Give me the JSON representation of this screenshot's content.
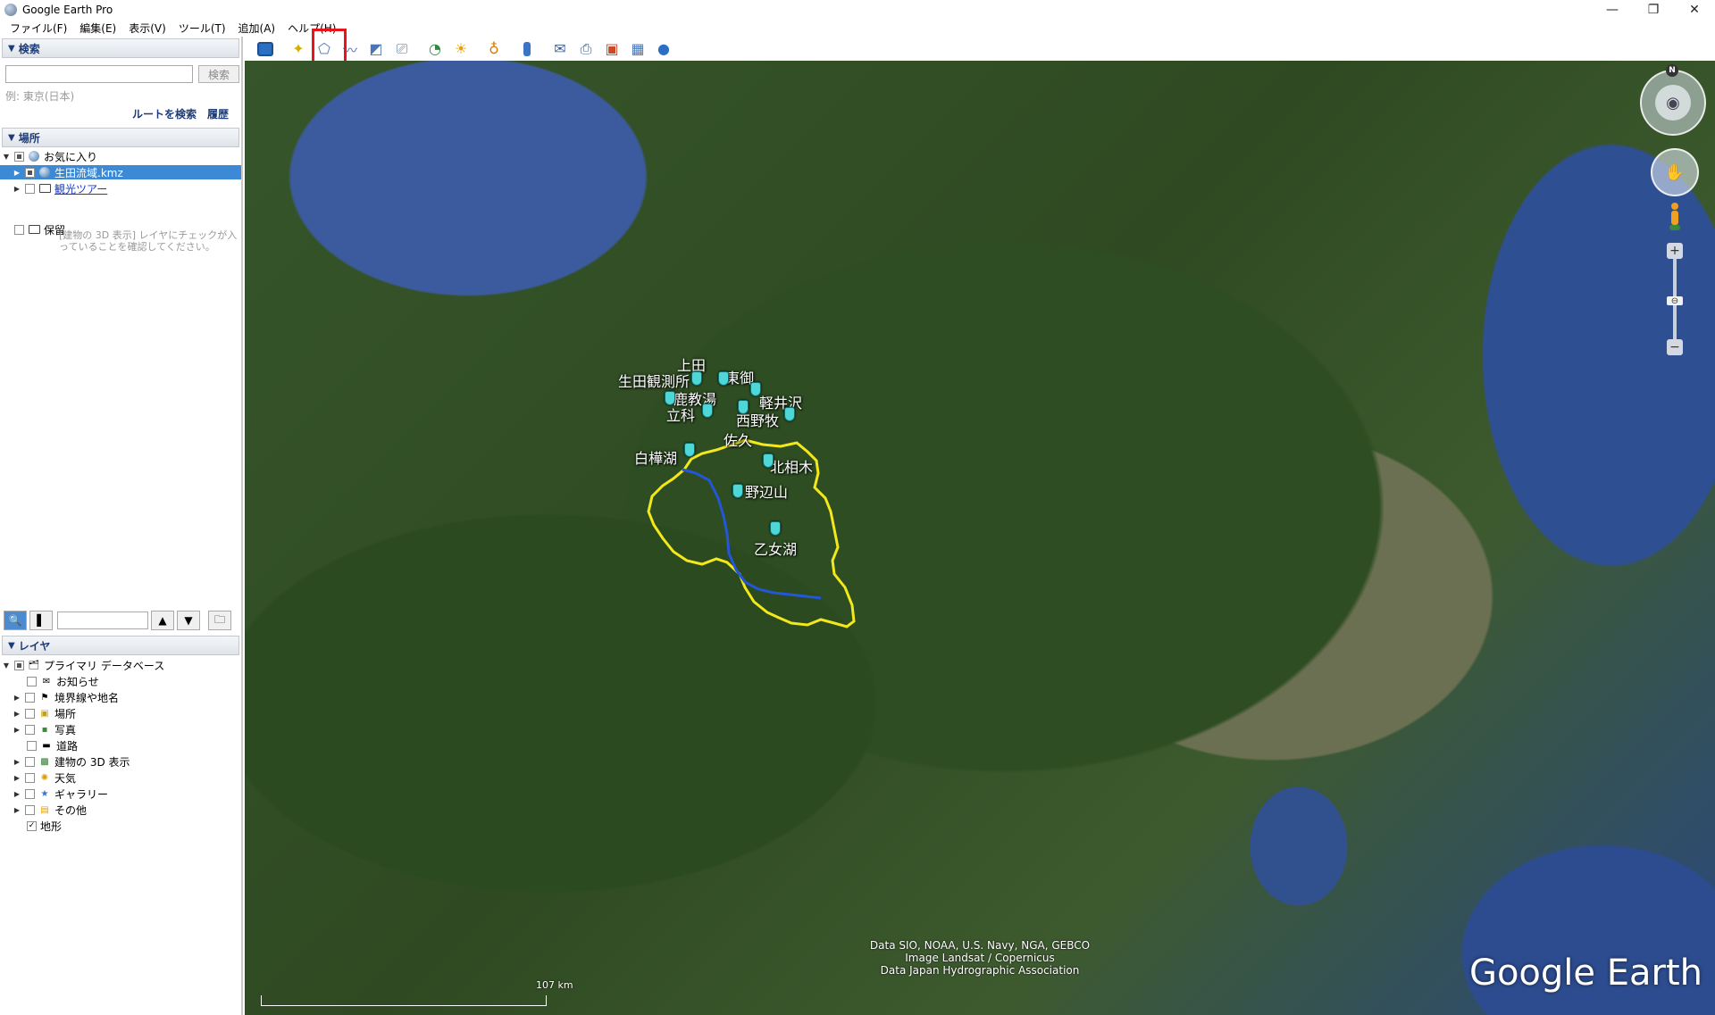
{
  "window": {
    "title": "Google Earth Pro",
    "controls": [
      "—",
      "❐",
      "✕"
    ]
  },
  "menu": [
    "ファイル(F)",
    "編集(E)",
    "表示(V)",
    "ツール(T)",
    "追加(A)",
    "ヘルプ(H)"
  ],
  "search": {
    "header": "検索",
    "input_value": "",
    "button_label": "検索",
    "example": "例: 東京(日本)",
    "route_label": "ルートを検索",
    "history_label": "履歴"
  },
  "places": {
    "header": "場所",
    "items": [
      {
        "label": "お気に入り"
      },
      {
        "label": "生田流域.kmz"
      },
      {
        "label": "観光ツアー"
      },
      {
        "label": "保留"
      }
    ],
    "tour_note": "[建物の 3D 表示] レイヤにチェックが入っていることを確認してください。"
  },
  "layers": {
    "header": "レイヤ",
    "items": [
      {
        "label": "プライマリ データベース"
      },
      {
        "label": "お知らせ"
      },
      {
        "label": "境界線や地名"
      },
      {
        "label": "場所"
      },
      {
        "label": "写真"
      },
      {
        "label": "道路"
      },
      {
        "label": "建物の 3D 表示"
      },
      {
        "label": "天気"
      },
      {
        "label": "ギャラリー"
      },
      {
        "label": "その他"
      },
      {
        "label": "地形"
      }
    ]
  },
  "map": {
    "labels": [
      {
        "text": "上田"
      },
      {
        "text": "東御"
      },
      {
        "text": "生田観測所"
      },
      {
        "text": "鹿教湯"
      },
      {
        "text": "軽井沢"
      },
      {
        "text": "立科"
      },
      {
        "text": "西野牧"
      },
      {
        "text": "佐久"
      },
      {
        "text": "白樺湖"
      },
      {
        "text": "北相木"
      },
      {
        "text": "野辺山"
      },
      {
        "text": "乙女湖"
      }
    ],
    "attribution": [
      "Data SIO, NOAA, U.S. Navy, NGA, GEBCO",
      "Image Landsat / Copernicus",
      "Data Japan Hydrographic Association"
    ],
    "scale": "107 km",
    "logo": "Google Earth",
    "compass_north": "N",
    "watershed_color": "#f2e81a",
    "river_color": "#2456d8",
    "pin_color": "#4fd6d6",
    "highlight_color": "#e8151b"
  }
}
